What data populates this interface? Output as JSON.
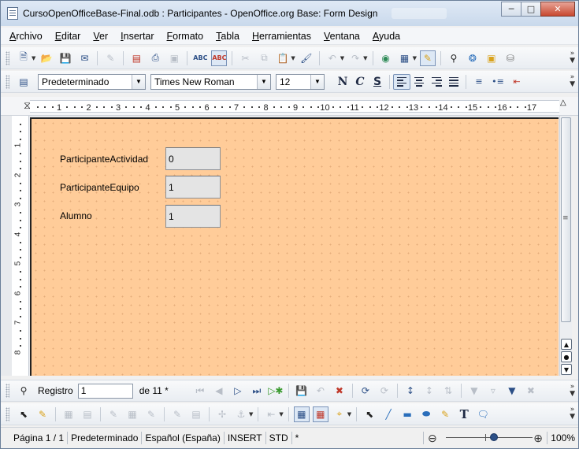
{
  "window": {
    "title": "CursoOpenOfficeBase-Final.odb : Participantes - OpenOffice.org Base: Form Design",
    "controls": {
      "minimize": "─",
      "maximize": "□",
      "close": "✕"
    }
  },
  "menu": {
    "items": [
      {
        "key": "A",
        "rest": "rchivo"
      },
      {
        "key": "E",
        "rest": "ditar"
      },
      {
        "key": "V",
        "rest": "er"
      },
      {
        "key": "I",
        "rest": "nsertar"
      },
      {
        "key": "F",
        "rest": "ormato"
      },
      {
        "key": "T",
        "rest": "abla"
      },
      {
        "key": "H",
        "rest": "erramientas"
      },
      {
        "key": "V",
        "rest": "entana",
        "prefix": ""
      },
      {
        "key": "A",
        "rest": "yuda"
      }
    ]
  },
  "format_toolbar": {
    "style": "Predeterminado",
    "font": "Times New Roman",
    "size": "12",
    "bold": "N",
    "italic": "C",
    "underline": "S"
  },
  "ruler": {
    "numbers": [
      "1",
      "2",
      "3",
      "4",
      "5",
      "6",
      "7",
      "8",
      "9",
      "10",
      "11",
      "12",
      "13",
      "14",
      "15",
      "16",
      "17"
    ],
    "vnumbers": [
      "1",
      "2",
      "3",
      "4",
      "5",
      "6",
      "7",
      "8"
    ]
  },
  "form": {
    "fields": [
      {
        "label": "ParticipanteActividad",
        "value": "0"
      },
      {
        "label": "ParticipanteEquipo",
        "value": "1"
      },
      {
        "label": "Alumno",
        "value": "1"
      }
    ],
    "background_color": "#ffcc99"
  },
  "navigation": {
    "record_label": "Registro",
    "record_value": "1",
    "total_label": "de 11 *"
  },
  "status": {
    "page": "Página  1 / 1",
    "style": "Predeterminado",
    "language": "Español (España)",
    "insert_mode": "INSERT",
    "selection_mode": "STD",
    "modified": "*",
    "zoom": "100%",
    "zoom_level": 100
  }
}
